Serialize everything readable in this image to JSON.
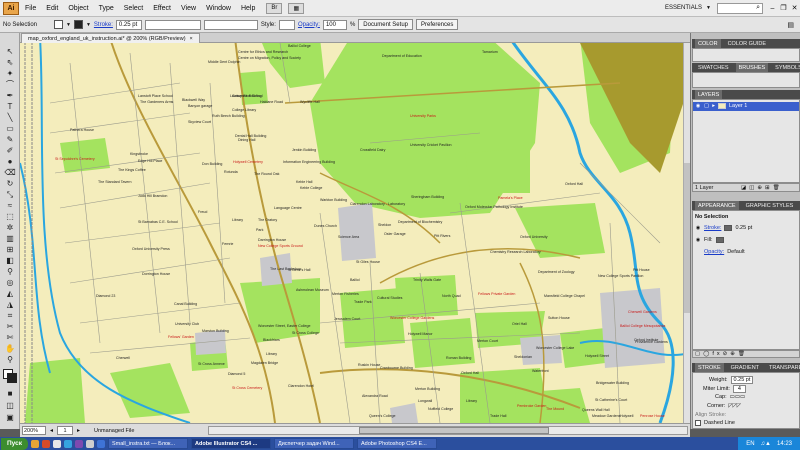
{
  "app": {
    "logo": "Ai",
    "workspace": "ESSENTIALS",
    "bridge_label": "Br"
  },
  "menu": [
    "File",
    "Edit",
    "Object",
    "Type",
    "Select",
    "Effect",
    "View",
    "Window",
    "Help"
  ],
  "control": {
    "selection": "No Selection",
    "stroke_label": "Stroke:",
    "stroke_value": "0.25 pt",
    "style_label": "Style:",
    "opacity_label": "Opacity:",
    "opacity_value": "100",
    "opacity_unit": "%",
    "doc_setup": "Document Setup",
    "preferences": "Preferences"
  },
  "document": {
    "tab_title": "map_oxford_england_uk_instruction.ai* @ 200% (RGB/Preview)",
    "close": "×",
    "zoom": "200%",
    "page": "1",
    "status": "Unmanaged File"
  },
  "panels": {
    "color": {
      "tabs": [
        "COLOR",
        "COLOR GUIDE"
      ]
    },
    "swatches": {
      "tabs": [
        "SWATCHES",
        "BRUSHES",
        "SYMBOLS"
      ]
    },
    "layers": {
      "tab": "LAYERS",
      "layer_name": "Layer 1",
      "footer": "1 Layer"
    },
    "appearance": {
      "tabs": [
        "APPEARANCE",
        "GRAPHIC STYLES"
      ],
      "title": "No Selection",
      "stroke_label": "Stroke:",
      "stroke_value": "0.25 pt",
      "fill_label": "Fill:",
      "opacity_label": "Opacity:",
      "opacity_value": "Default"
    },
    "stroke": {
      "tabs": [
        "STROKE",
        "GRADIENT",
        "TRANSPARENCY"
      ],
      "weight_label": "Weight:",
      "weight_value": "0.25 pt",
      "miter_label": "Miter Limit:",
      "miter_value": "4",
      "cap_label": "Cap:",
      "corner_label": "Corner:",
      "align_label": "Align Stroke:",
      "dashed_label": "Dashed Line"
    }
  },
  "map": {
    "labels": [
      {
        "t": "Balliol College",
        "c": "dark"
      },
      {
        "t": "Centre for Ethics and Research",
        "c": "dark"
      },
      {
        "t": "Centre on Migration, Policy and Society",
        "c": "dark"
      },
      {
        "t": "Department of Education",
        "c": "dark"
      },
      {
        "t": "Tamarium",
        "c": "dark"
      },
      {
        "t": "Middle Dent Dolphin",
        "c": "dark"
      },
      {
        "t": "Colwynne Building",
        "c": "dark"
      },
      {
        "t": "Lawson Blue School",
        "c": "dark"
      },
      {
        "t": "Lanstoft Place School",
        "c": "dark"
      },
      {
        "t": "The Gardeners Arms",
        "c": "dark"
      },
      {
        "t": "Blackwell Way",
        "c": "dark"
      },
      {
        "t": "Banyon garage",
        "c": "dark"
      },
      {
        "t": "College Library",
        "c": "dark"
      },
      {
        "t": "Haldane Road",
        "c": "dark"
      },
      {
        "t": "Wycliffe Hall",
        "c": "dark"
      },
      {
        "t": "Ruth Beech Building",
        "c": "dark"
      },
      {
        "t": "Skyview Court",
        "c": "dark"
      },
      {
        "t": "Pathera House",
        "c": "dark"
      },
      {
        "t": "Dental Hall Building",
        "c": "dark"
      },
      {
        "t": "Kingsbroke",
        "c": "dark"
      },
      {
        "t": "Dining Hall",
        "c": "dark"
      },
      {
        "t": "University Parks",
        "c": "red"
      },
      {
        "t": "St Sepulchre's Cemetery",
        "c": "red"
      },
      {
        "t": "Edge Hill Place",
        "c": "dark"
      },
      {
        "t": "Don Building",
        "c": "dark"
      },
      {
        "t": "Rotunda",
        "c": "dark"
      },
      {
        "t": "Holywell Cemetery",
        "c": "red"
      },
      {
        "t": "Information Engineering Building",
        "c": "dark"
      },
      {
        "t": "Jenkin Building",
        "c": "dark"
      },
      {
        "t": "Crossfield Dairy",
        "c": "dark"
      },
      {
        "t": "University Cricket Pavilion",
        "c": "dark"
      },
      {
        "t": "The Kings Coffee",
        "c": "dark"
      },
      {
        "t": "The Round Oak",
        "c": "dark"
      },
      {
        "t": "The Standard Tavern",
        "c": "dark"
      },
      {
        "t": "Keble Hall",
        "c": "dark"
      },
      {
        "t": "Keble College",
        "c": "dark"
      },
      {
        "t": "Judd Hill Bramdon",
        "c": "dark"
      },
      {
        "t": "Warkton Building",
        "c": "dark"
      },
      {
        "t": "Clarendon Laboratory - Laboratory",
        "c": "dark"
      },
      {
        "t": "Sheringham Building",
        "c": "dark"
      },
      {
        "t": "Pamela's Place",
        "c": "red"
      },
      {
        "t": "Oxford Molecular Pathology Institute",
        "c": "dark"
      },
      {
        "t": "St Barnabas C.E. School",
        "c": "dark"
      },
      {
        "t": "Freud",
        "c": "dark"
      },
      {
        "t": "Library",
        "c": "dark"
      },
      {
        "t": "The Oratory",
        "c": "dark"
      },
      {
        "t": "Language Centre",
        "c": "dark"
      },
      {
        "t": "Department of Biochemistry",
        "c": "dark"
      },
      {
        "t": "Oxford University Press",
        "c": "dark"
      },
      {
        "t": "Fernrie",
        "c": "dark"
      },
      {
        "t": "Park",
        "c": "dark"
      },
      {
        "t": "Darrington House",
        "c": "dark"
      },
      {
        "t": "Dunes Church",
        "c": "dark"
      },
      {
        "t": "Sheldon",
        "c": "dark"
      },
      {
        "t": "Science Area",
        "c": "dark"
      },
      {
        "t": "Osler Garage",
        "c": "dark"
      },
      {
        "t": "Pitt Rivers",
        "c": "dark"
      },
      {
        "t": "Oxford University",
        "c": "dark"
      },
      {
        "t": "New College Sports Ground",
        "c": "red"
      },
      {
        "t": "Dorrington House",
        "c": "dark"
      },
      {
        "t": "The Last Bookshop",
        "c": "dark"
      },
      {
        "t": "St Bene's Hall",
        "c": "dark"
      },
      {
        "t": "St Giles House",
        "c": "dark"
      },
      {
        "t": "Chemistry Research Laboratory",
        "c": "dark"
      },
      {
        "t": "Department of Zoology",
        "c": "dark"
      },
      {
        "t": "New College Sports Pavilion",
        "c": "dark"
      },
      {
        "t": "Pitt House",
        "c": "dark"
      },
      {
        "t": "Diamond 23",
        "c": "dark"
      },
      {
        "t": "Canal Building",
        "c": "dark"
      },
      {
        "t": "Ashmolean Museum",
        "c": "dark"
      },
      {
        "t": "Balliol",
        "c": "dark"
      },
      {
        "t": "Trinity Walls Gate",
        "c": "dark"
      },
      {
        "t": "Mansfield College Chapel",
        "c": "dark"
      },
      {
        "t": "Merton Fisheries",
        "c": "dark"
      },
      {
        "t": "Cultural Studies",
        "c": "dark"
      },
      {
        "t": "North Quad",
        "c": "dark"
      },
      {
        "t": "Fellows Private Garden",
        "c": "red"
      },
      {
        "t": "Trade Park",
        "c": "dark"
      },
      {
        "t": "University Club",
        "c": "dark"
      },
      {
        "t": "Jerusalem Court",
        "c": "dark"
      },
      {
        "t": "Worcester College Gardens",
        "c": "red"
      },
      {
        "t": "Fellows' Garden",
        "c": "red"
      },
      {
        "t": "Marston Building",
        "c": "dark"
      },
      {
        "t": "Worcester Street, Easter College",
        "c": "dark"
      },
      {
        "t": "St Cross College",
        "c": "dark"
      },
      {
        "t": "Blackfriars",
        "c": "dark"
      },
      {
        "t": "Oriel Hall",
        "c": "dark"
      },
      {
        "t": "Sutton House",
        "c": "dark"
      },
      {
        "t": "Balliol College Mesopotamia",
        "c": "red"
      },
      {
        "t": "Holywell Manor",
        "c": "dark"
      },
      {
        "t": "Merton Court",
        "c": "dark"
      },
      {
        "t": "Cherwell",
        "c": "dark"
      },
      {
        "t": "St Cross Annexe",
        "c": "dark"
      },
      {
        "t": "Worcester College Lake",
        "c": "dark"
      },
      {
        "t": "Providence Gardens",
        "c": "dark"
      },
      {
        "t": "Cherwell Gardens",
        "c": "red"
      },
      {
        "t": "Oxford Institute",
        "c": "dark"
      },
      {
        "t": "Library",
        "c": "dark"
      },
      {
        "t": "Diamond 5",
        "c": "dark"
      },
      {
        "t": "Roman Building",
        "c": "dark"
      },
      {
        "t": "Ruskin House",
        "c": "dark"
      },
      {
        "t": "Sheldonian",
        "c": "dark"
      },
      {
        "t": "Holywell Street",
        "c": "dark"
      },
      {
        "t": "St Cross Cemetery",
        "c": "red"
      },
      {
        "t": "Cranbourne Building",
        "c": "dark"
      },
      {
        "t": "Oxford Hall",
        "c": "dark"
      },
      {
        "t": "Merton Building",
        "c": "dark"
      },
      {
        "t": "Bridgewater Building",
        "c": "dark"
      },
      {
        "t": "Waterfront",
        "c": "dark"
      },
      {
        "t": "Nuffield College",
        "c": "dark"
      },
      {
        "t": "Alexandra Road",
        "c": "dark"
      },
      {
        "t": "Longwall",
        "c": "dark"
      },
      {
        "t": "Library",
        "c": "dark"
      },
      {
        "t": "St Catherine's Court",
        "c": "dark"
      },
      {
        "t": "Queen's College",
        "c": "dark"
      },
      {
        "t": "Pembroke Garden",
        "c": "red"
      },
      {
        "t": "The Mound",
        "c": "red"
      },
      {
        "t": "Queens Wall Hall",
        "c": "dark"
      },
      {
        "t": "Meadow Gardens",
        "c": "dark"
      },
      {
        "t": "Oxford Hall",
        "c": "dark"
      },
      {
        "t": "Trade Hall",
        "c": "dark"
      },
      {
        "t": "Penrose House",
        "c": "red"
      },
      {
        "t": "Holywell",
        "c": "dark"
      },
      {
        "t": "Magdalen Bridge",
        "c": "dark"
      },
      {
        "t": "Clarendon Hotel",
        "c": "dark"
      }
    ]
  },
  "taskbar": {
    "start": "Пуск",
    "tasks": [
      "Small_instra.txt — Блок...",
      "Adobe Illustrator CS4 ...",
      "Диспетчер задач Wind...",
      "Adobe Photoshop CS4 E..."
    ],
    "tray_lang": "EN",
    "clock": "14:23"
  },
  "colors": {
    "map_base": "#f4edbc",
    "park": "#a4e35f",
    "river": "#2aa6e0",
    "road_major": "#b99a3b",
    "building": "#c8c8cc",
    "olive": "#a79a2e"
  }
}
